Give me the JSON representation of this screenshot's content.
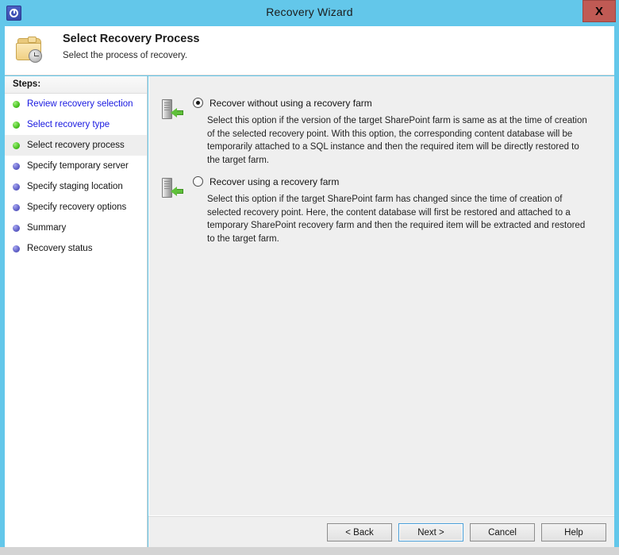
{
  "window": {
    "title": "Recovery Wizard",
    "title_icon": "recovery-clock-icon",
    "close_label": "X",
    "accent_color": "#63c7ea",
    "close_color": "#c05a54"
  },
  "header": {
    "icon": "folder-clock-icon",
    "title": "Select Recovery Process",
    "subtitle": "Select the process of recovery."
  },
  "sidebar": {
    "heading": "Steps:",
    "items": [
      {
        "label": "Review recovery selection",
        "state": "done"
      },
      {
        "label": "Select recovery type",
        "state": "done"
      },
      {
        "label": "Select recovery process",
        "state": "current"
      },
      {
        "label": "Specify temporary server",
        "state": "pending"
      },
      {
        "label": "Specify staging location",
        "state": "pending"
      },
      {
        "label": "Specify recovery options",
        "state": "pending"
      },
      {
        "label": "Summary",
        "state": "pending"
      },
      {
        "label": "Recovery status",
        "state": "pending"
      }
    ]
  },
  "main": {
    "options": [
      {
        "icon": "server-restore-icon",
        "label": "Recover without using a recovery farm",
        "selected": true,
        "description": "Select this option if the version of the target SharePoint farm is same as at the time of creation of the selected recovery point. With this option, the corresponding content database will be temporarily attached to a SQL instance and then the required item will be directly restored to the target farm."
      },
      {
        "icon": "server-restore-icon",
        "label": "Recover using a recovery farm",
        "selected": false,
        "description": "Select this option if the target SharePoint farm has changed since the time of creation of selected recovery point. Here, the content database will first be restored and attached to a temporary SharePoint recovery farm and then the required item will be extracted and restored to the target farm."
      }
    ]
  },
  "footer": {
    "buttons": [
      {
        "label": "< Back",
        "focused": false
      },
      {
        "label": "Next >",
        "focused": true
      },
      {
        "label": "Cancel",
        "focused": false
      },
      {
        "label": "Help",
        "focused": false
      }
    ]
  }
}
